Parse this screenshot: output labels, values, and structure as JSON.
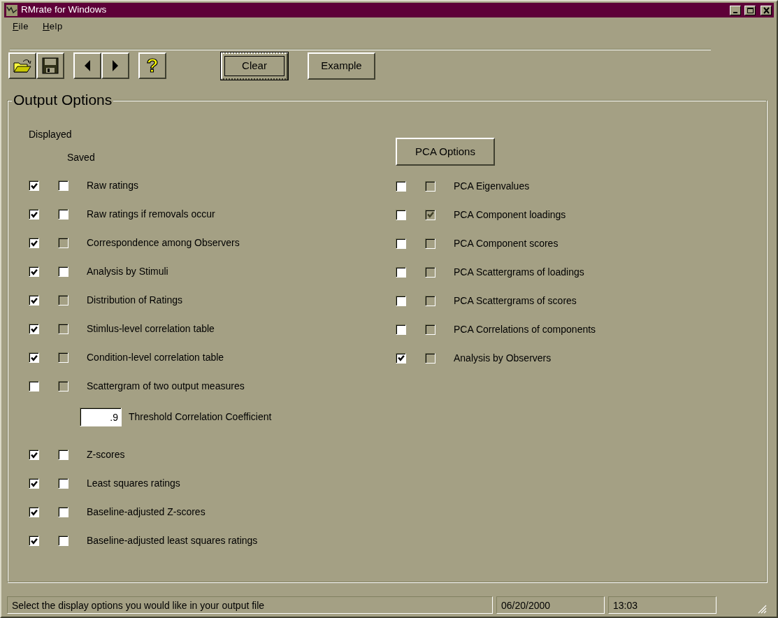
{
  "window": {
    "title": "RMrate for Windows"
  },
  "menu": [
    {
      "label": "File"
    },
    {
      "label": "Help"
    }
  ],
  "toolbar": [
    {
      "kind": "open"
    },
    {
      "kind": "save"
    },
    {
      "kind": "back"
    },
    {
      "kind": "forward"
    },
    {
      "kind": "help",
      "label": "?"
    }
  ],
  "buttons": [
    {
      "label": "Clear",
      "focused": true
    },
    {
      "label": "Example",
      "focused": false
    }
  ],
  "group": {
    "title": "Output Options",
    "displayed_header": "Displayed",
    "saved_header": "Saved",
    "pca_button": "PCA Options",
    "left_options": [
      {
        "kind": "option",
        "label": "Raw ratings",
        "displayed": {
          "checked": true,
          "disabled": false
        },
        "saved": {
          "checked": false,
          "disabled": false
        }
      },
      {
        "kind": "option",
        "label": "Raw ratings if removals occur",
        "displayed": {
          "checked": true,
          "disabled": false
        },
        "saved": {
          "checked": false,
          "disabled": false
        }
      },
      {
        "kind": "option",
        "label": "Correspondence among Observers",
        "displayed": {
          "checked": true,
          "disabled": false
        },
        "saved": {
          "checked": false,
          "disabled": true
        }
      },
      {
        "kind": "option",
        "label": "Analysis by Stimuli",
        "displayed": {
          "checked": true,
          "disabled": false
        },
        "saved": {
          "checked": false,
          "disabled": false
        }
      },
      {
        "kind": "option",
        "label": "Distribution of Ratings",
        "displayed": {
          "checked": true,
          "disabled": false
        },
        "saved": {
          "checked": false,
          "disabled": true
        }
      },
      {
        "kind": "option",
        "label": "Stimlus-level correlation table",
        "displayed": {
          "checked": true,
          "disabled": false
        },
        "saved": {
          "checked": false,
          "disabled": true
        }
      },
      {
        "kind": "option",
        "label": "Condition-level correlation table",
        "displayed": {
          "checked": true,
          "disabled": false
        },
        "saved": {
          "checked": false,
          "disabled": true
        }
      },
      {
        "kind": "option",
        "label": "Scattergram of two output measures",
        "displayed": {
          "checked": false,
          "disabled": false
        },
        "saved": {
          "checked": false,
          "disabled": true
        }
      },
      {
        "kind": "threshold",
        "value": ".9",
        "label": "Threshold Correlation Coefficient"
      },
      {
        "kind": "option",
        "label": "Z-scores",
        "displayed": {
          "checked": true,
          "disabled": false
        },
        "saved": {
          "checked": false,
          "disabled": false
        }
      },
      {
        "kind": "option",
        "label": "Least squares ratings",
        "displayed": {
          "checked": true,
          "disabled": false
        },
        "saved": {
          "checked": false,
          "disabled": false
        }
      },
      {
        "kind": "option",
        "label": "Baseline-adjusted Z-scores",
        "displayed": {
          "checked": true,
          "disabled": false
        },
        "saved": {
          "checked": false,
          "disabled": false
        }
      },
      {
        "kind": "option",
        "label": "Baseline-adjusted least squares ratings",
        "displayed": {
          "checked": true,
          "disabled": false
        },
        "saved": {
          "checked": false,
          "disabled": false
        }
      }
    ],
    "right_options": [
      {
        "kind": "option",
        "label": "PCA Eigenvalues",
        "displayed": {
          "checked": false,
          "disabled": false
        },
        "saved": {
          "checked": false,
          "disabled": true
        }
      },
      {
        "kind": "option",
        "label": "PCA Component loadings",
        "displayed": {
          "checked": false,
          "disabled": false
        },
        "saved": {
          "checked": true,
          "disabled": true
        }
      },
      {
        "kind": "option",
        "label": "PCA Component scores",
        "displayed": {
          "checked": false,
          "disabled": false
        },
        "saved": {
          "checked": false,
          "disabled": true
        }
      },
      {
        "kind": "option",
        "label": "PCA Scattergrams of loadings",
        "displayed": {
          "checked": false,
          "disabled": false
        },
        "saved": {
          "checked": false,
          "disabled": true
        }
      },
      {
        "kind": "option",
        "label": "PCA Scattergrams of scores",
        "displayed": {
          "checked": false,
          "disabled": false
        },
        "saved": {
          "checked": false,
          "disabled": true
        }
      },
      {
        "kind": "option",
        "label": "PCA Correlations of components",
        "displayed": {
          "checked": false,
          "disabled": false
        },
        "saved": {
          "checked": false,
          "disabled": true
        }
      },
      {
        "kind": "option",
        "label": "Analysis by Observers",
        "displayed": {
          "checked": true,
          "disabled": false
        },
        "saved": {
          "checked": false,
          "disabled": true
        }
      }
    ]
  },
  "status_bar": {
    "message": "Select the display options you would like in your output file",
    "date": "06/20/2000",
    "time": "13:03"
  }
}
